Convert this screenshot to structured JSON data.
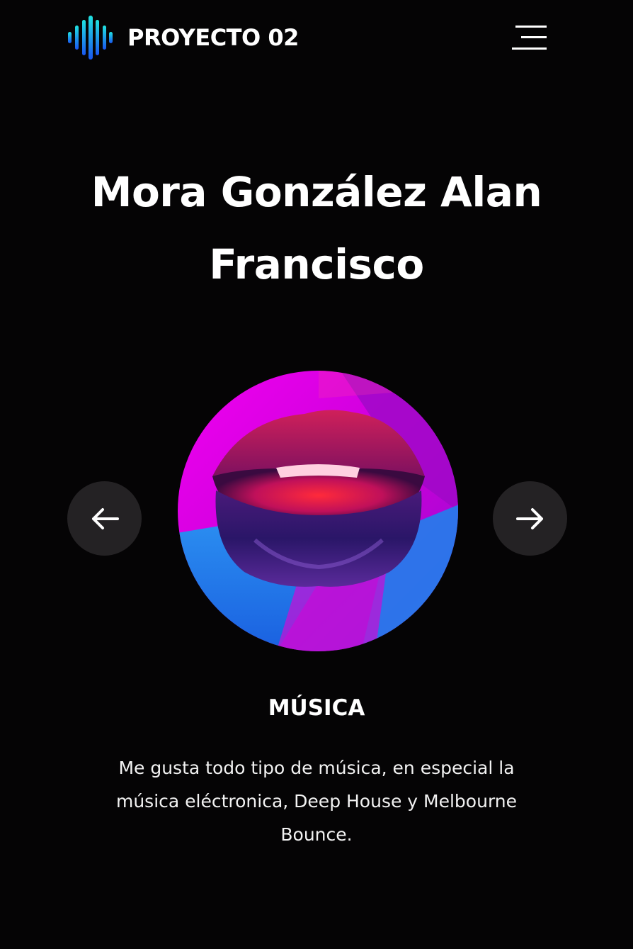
{
  "header": {
    "brand": "PROYECTO 02",
    "logo_icon": "sound-wave-icon",
    "menu_icon": "hamburger-menu-icon"
  },
  "hero": {
    "title": "Mora González Alan Francisco"
  },
  "carousel": {
    "prev_icon": "arrow-left-icon",
    "next_icon": "arrow-right-icon",
    "slide_image": "neon-lips-illustration",
    "caption": "MÚSICA",
    "description": "Me gusta todo tipo de música, en especial la música eléctronica, Deep House y Melbourne Bounce."
  },
  "colors": {
    "background": "#050405",
    "text": "#ffffff",
    "nav_button": "#242224",
    "logo_gradient_start": "#19d3e0",
    "logo_gradient_end": "#1a5cf0",
    "accent_magenta": "#e800e8",
    "accent_blue": "#1e88f0"
  }
}
